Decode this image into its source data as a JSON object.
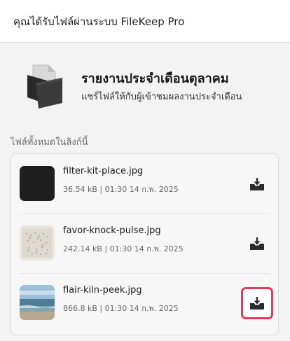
{
  "header": {
    "title": "คุณได้รับไฟล์ผ่านระบบ FileKeep Pro"
  },
  "share": {
    "title": "รายงานประจำเดือนตุลาคม",
    "subtitle": "แชร์ไฟล์ให้กับผู้เข้าชมผลงานประจำเดือน",
    "icon": "folder-documents-icon"
  },
  "files_section": {
    "label": "ไฟล์ทั้งหมดในลิงก์นี้",
    "files": [
      {
        "name": "filter-kit-place.jpg",
        "meta": "36.54 kB | 01:30 14 ก.พ. 2025",
        "thumb": "dark"
      },
      {
        "name": "favor-knock-pulse.jpg",
        "meta": "242.14 kB | 01:30 14 ก.พ. 2025",
        "thumb": "pattern"
      },
      {
        "name": "flair-kiln-peek.jpg",
        "meta": "866.8 kB | 01:30 14 ก.พ. 2025",
        "thumb": "beach"
      }
    ]
  },
  "colors": {
    "focus_ring": "#e23b5c",
    "text": "#1c1c1c",
    "muted": "#666666"
  }
}
